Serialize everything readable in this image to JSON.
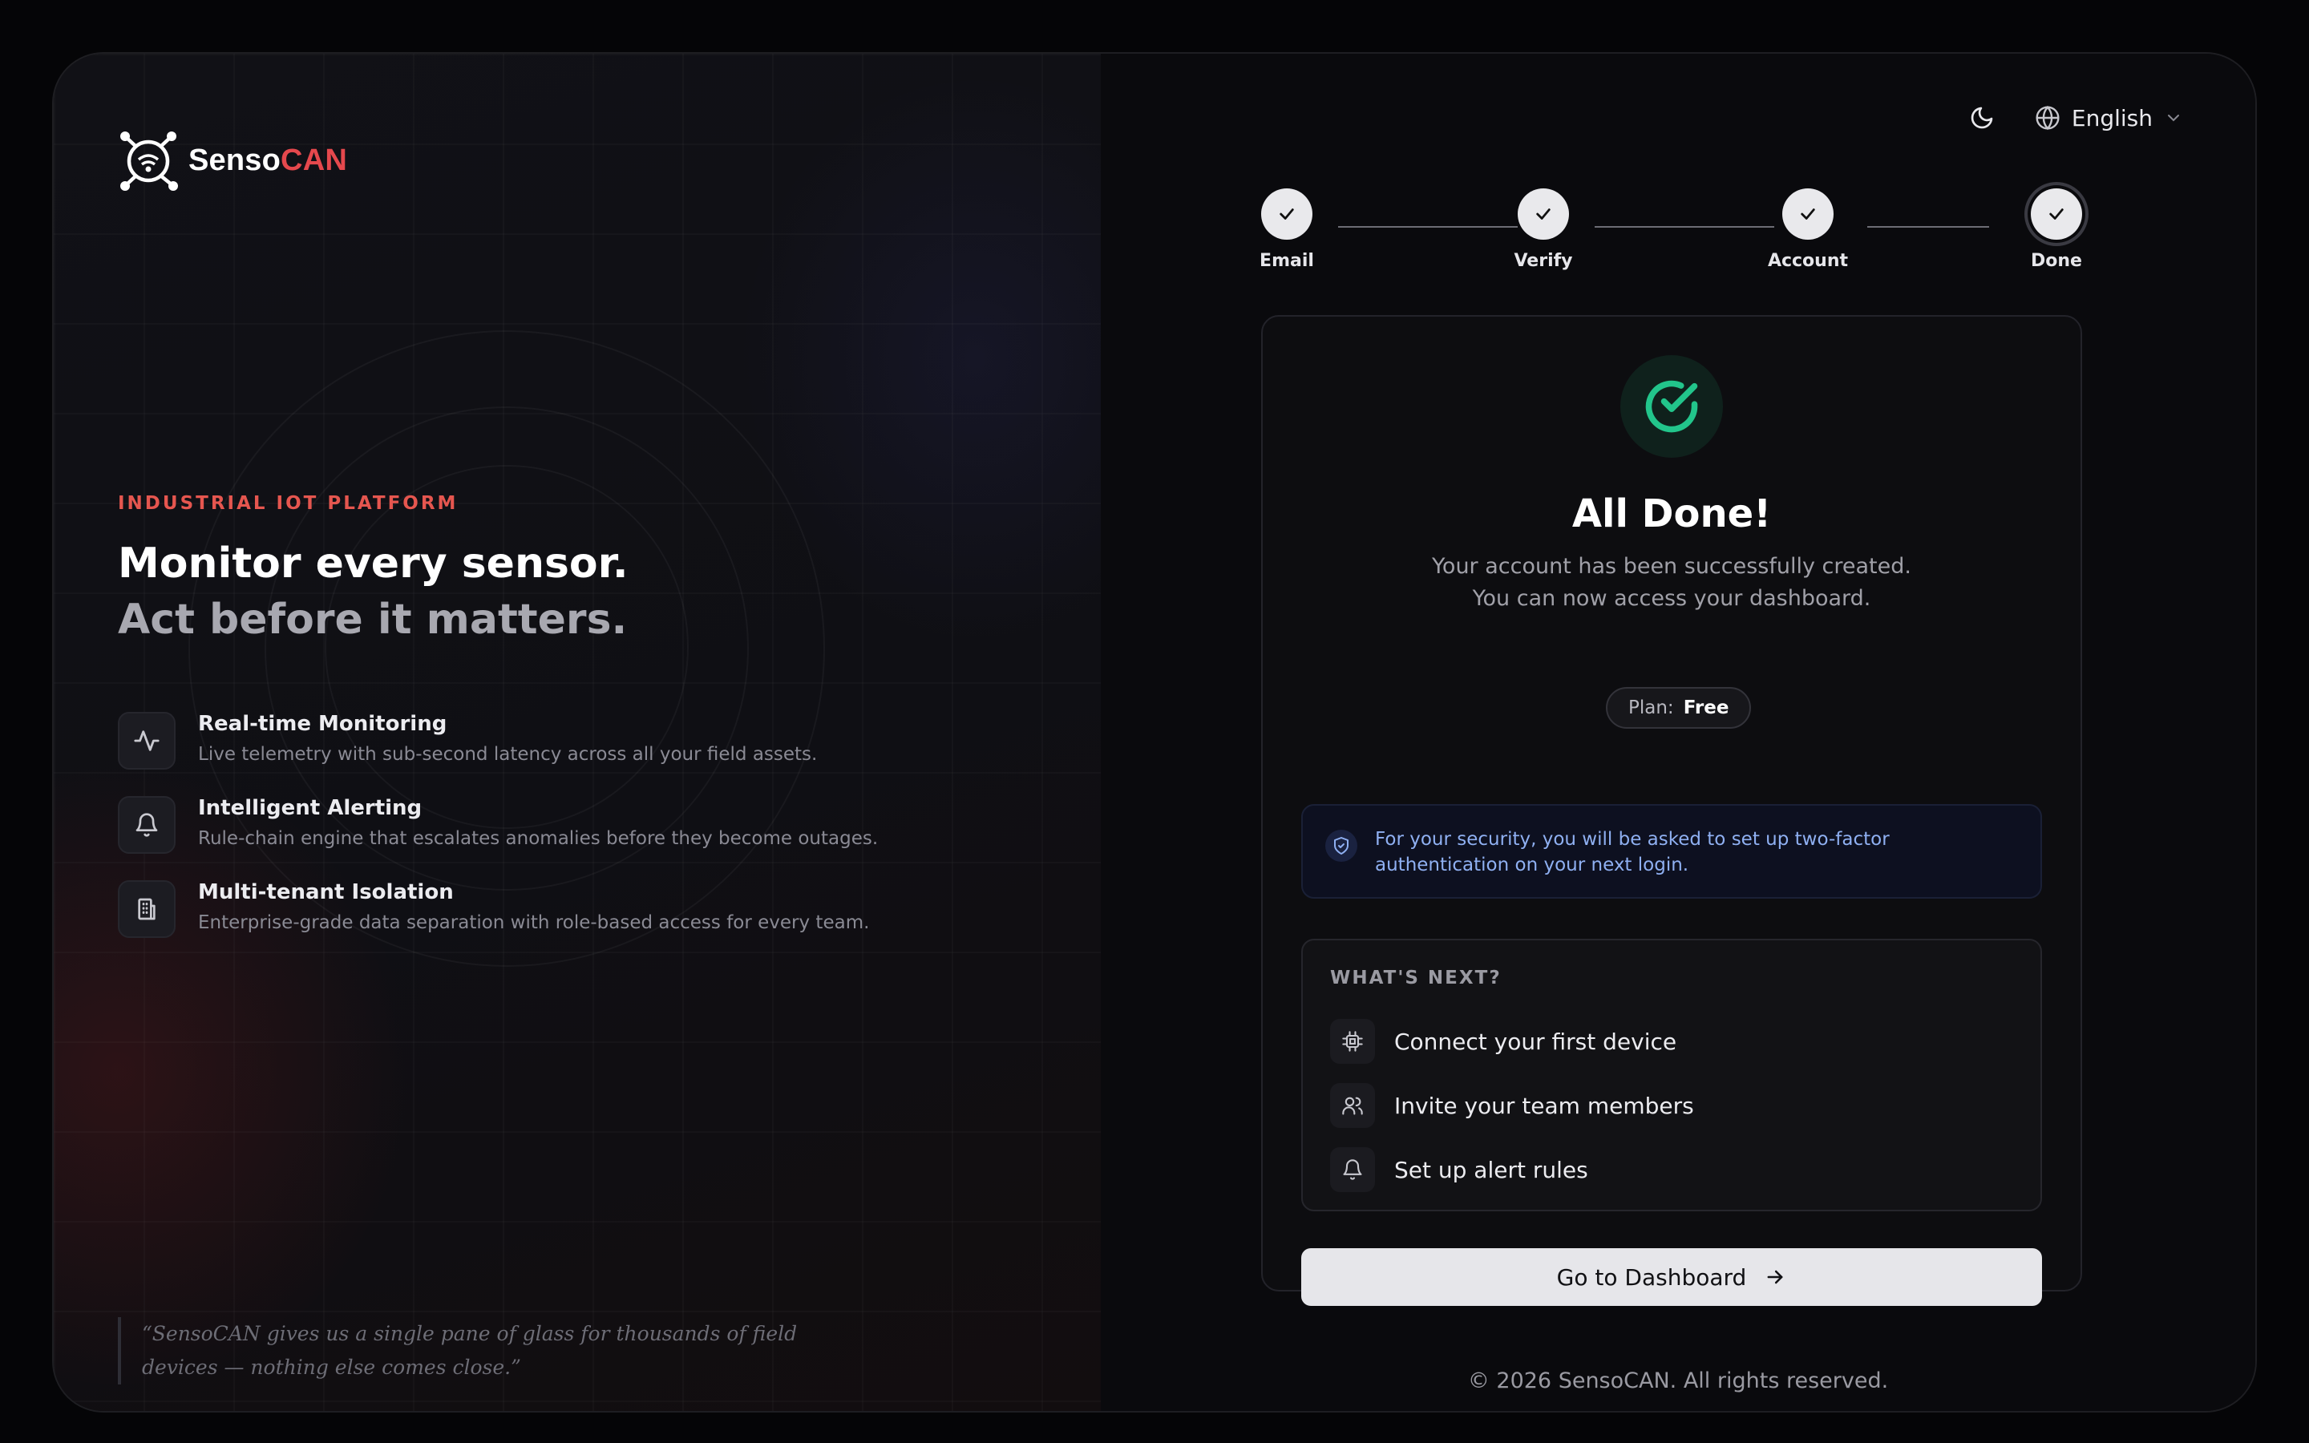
{
  "brand": {
    "name_primary": "Senso",
    "name_accent": "CAN"
  },
  "hero": {
    "eyebrow": "INDUSTRIAL IOT PLATFORM",
    "headline_line1": "Monitor every sensor.",
    "headline_line2": "Act before it matters."
  },
  "features": [
    {
      "icon": "activity-icon",
      "title": "Real-time Monitoring",
      "desc": "Live telemetry with sub-second latency across all your field assets."
    },
    {
      "icon": "bell-icon",
      "title": "Intelligent Alerting",
      "desc": "Rule-chain engine that escalates anomalies before they become outages."
    },
    {
      "icon": "building-icon",
      "title": "Multi-tenant Isolation",
      "desc": "Enterprise-grade data separation with role-based access for every team."
    }
  ],
  "quote": {
    "line1": "“SensoCAN gives us a single pane of glass for thousands of field",
    "line2": "devices — nothing else comes close.”"
  },
  "top_controls": {
    "theme_icon": "moon-icon",
    "language": "English"
  },
  "steps": [
    {
      "label": "Email",
      "state": "complete"
    },
    {
      "label": "Verify",
      "state": "complete"
    },
    {
      "label": "Account",
      "state": "complete"
    },
    {
      "label": "Done",
      "state": "current"
    }
  ],
  "result": {
    "title": "All Done!",
    "subtitle_line1": "Your account has been successfully created.",
    "subtitle_line2": "You can now access your dashboard.",
    "plan_label": "Plan:",
    "plan_value": "Free"
  },
  "notice": {
    "text": "For your security, you will be asked to set up two-factor authentication on your next login."
  },
  "whats_next": {
    "title": "WHAT'S NEXT?",
    "items": [
      {
        "icon": "chip-icon",
        "label": "Connect your first device"
      },
      {
        "icon": "users-icon",
        "label": "Invite your team members"
      },
      {
        "icon": "bell-icon",
        "label": "Set up alert rules"
      }
    ]
  },
  "cta": {
    "label": "Go to Dashboard"
  },
  "footer": {
    "text": "© 2026 SensoCAN. All rights reserved."
  },
  "colors": {
    "accent_red": "#e5484d",
    "success_green": "#22c58b",
    "info_blue": "#8fb0f2"
  }
}
